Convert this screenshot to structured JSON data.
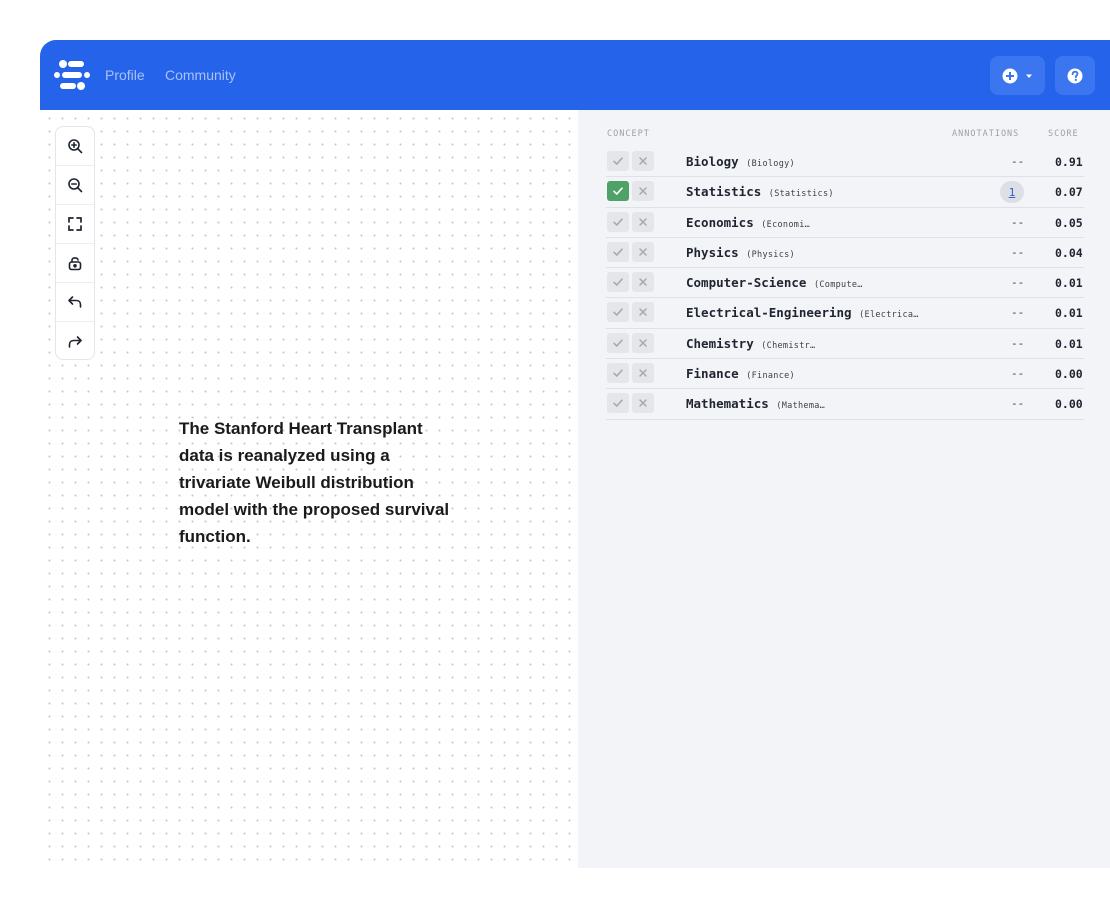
{
  "nav": {
    "profile": "Profile",
    "community": "Community"
  },
  "note": {
    "text": "The Stanford Heart Transplant data is reanalyzed using a trivariate Weibull distribution model with the proposed survival function."
  },
  "panel": {
    "headers": {
      "concept": "CONCEPT",
      "annotations": "ANNOTATIONS",
      "score": "SCORE"
    },
    "rows": [
      {
        "name": "Biology",
        "sub": "(Biology)",
        "annotations": "--",
        "score": "0.91",
        "accepted": false
      },
      {
        "name": "Statistics",
        "sub": "(Statistics)",
        "annotations": "1",
        "score": "0.07",
        "accepted": true
      },
      {
        "name": "Economics",
        "sub": "(Economi…",
        "annotations": "--",
        "score": "0.05",
        "accepted": false
      },
      {
        "name": "Physics",
        "sub": "(Physics)",
        "annotations": "--",
        "score": "0.04",
        "accepted": false
      },
      {
        "name": "Computer-Science",
        "sub": "(Compute…",
        "annotations": "--",
        "score": "0.01",
        "accepted": false
      },
      {
        "name": "Electrical-Engineering",
        "sub": "(Electrica…",
        "annotations": "--",
        "score": "0.01",
        "accepted": false
      },
      {
        "name": "Chemistry",
        "sub": "(Chemistr…",
        "annotations": "--",
        "score": "0.01",
        "accepted": false
      },
      {
        "name": "Finance",
        "sub": "(Finance)",
        "annotations": "--",
        "score": "0.00",
        "accepted": false
      },
      {
        "name": "Mathematics",
        "sub": "(Mathema…",
        "annotations": "--",
        "score": "0.00",
        "accepted": false
      }
    ]
  },
  "icons": {
    "logo": "logo-icon",
    "add": "plus-circle-icon",
    "dropdown": "caret-down-icon",
    "help": "help-icon",
    "zoom_in": "zoom-in-icon",
    "zoom_out": "zoom-out-icon",
    "fit": "fit-view-icon",
    "lock": "unlock-icon",
    "undo": "undo-icon",
    "redo": "redo-icon"
  },
  "colors": {
    "topbar": "#2563eb",
    "accept_on": "#4fa267"
  }
}
